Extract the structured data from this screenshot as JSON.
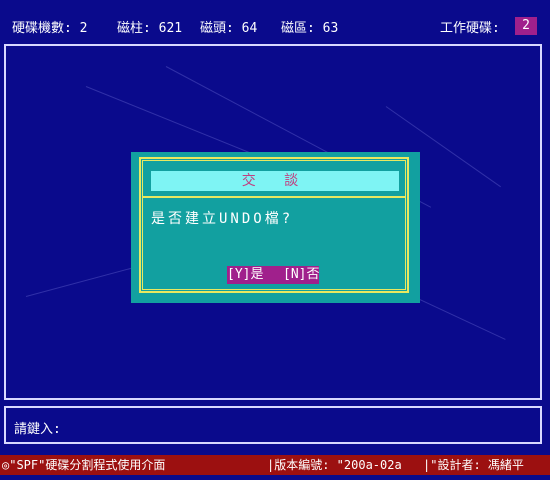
{
  "topbar": {
    "disk_count_label": "硬碟機數: 2",
    "cylinders_label": "磁柱: 621",
    "heads_label": "磁頭: 64",
    "sectors_label": "磁區: 63",
    "work_disk_label": "工作硬碟:",
    "work_disk_value": "2"
  },
  "dialog": {
    "title": "交 談",
    "message": "是否建立UNDO檔?",
    "yes_label": "[Y]是",
    "no_label": "[N]否"
  },
  "prompt": {
    "label": "請鍵入:",
    "value": ""
  },
  "statusbar": {
    "left": "◎\"SPF\"硬碟分割程式使用介面",
    "mid": "|版本編號: \"200a-02a",
    "right": "|\"設計者: 馮緒平"
  },
  "colors": {
    "background": "#0a0a8c",
    "dialog_bg": "#12a0a0",
    "dialog_title_bg": "#7ef4f4",
    "button_bg": "#a0208c",
    "statusbar_bg": "#9c1010",
    "frame_line": "#e8e860"
  }
}
